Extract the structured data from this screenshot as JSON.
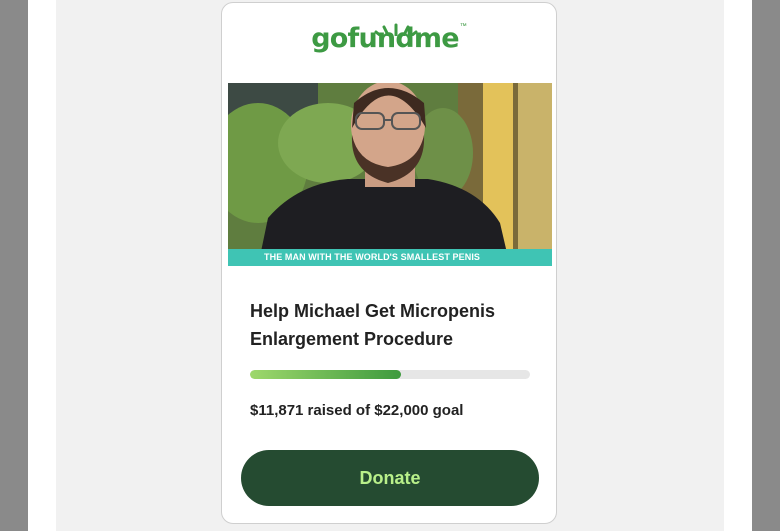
{
  "brand": {
    "name": "gofundme",
    "trademark": "™",
    "color": "#3d9a43"
  },
  "campaign": {
    "image_caption": "THE MAN WITH THE WORLD'S SMALLEST PENIS",
    "title": "Help Michael Get Micropenis Enlargement Procedure",
    "progress_fraction": 0.54,
    "raised_text": "$11,871 raised of $22,000 goal",
    "raised_amount": 11871,
    "goal_amount": 22000
  },
  "actions": {
    "donate_label": "Donate"
  },
  "colors": {
    "accent": "#254b31",
    "button_text": "#b9f08a",
    "caption_bar": "#3fc4b4"
  }
}
